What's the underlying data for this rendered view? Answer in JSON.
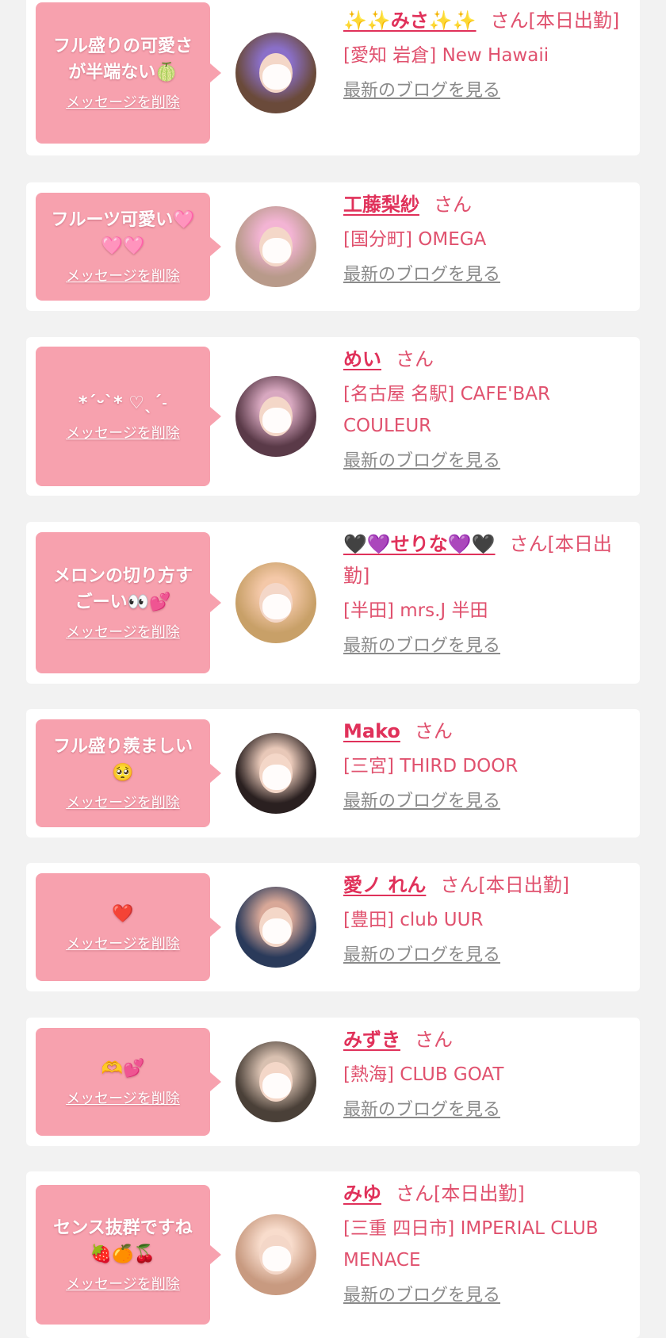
{
  "common": {
    "delete_label": "メッセージを削除",
    "blog_label": "最新のブログを見る",
    "san": "さん"
  },
  "colors": {
    "page_background": "#f2f2f2",
    "card_background": "#ffffff",
    "bubble": "#f7a1ae",
    "accent": "#e0315a",
    "shop_text": "#e0516e",
    "blog_link": "#8a8a8a"
  },
  "entries": [
    {
      "message": "フル盛りの可愛さ\nが半端ない🍈",
      "name": "✨✨みさ✨✨",
      "status": "[本日出勤]",
      "shop": "[愛知 岩倉] New Hawaii",
      "avatar_colors": [
        "#6a4a3a",
        "#8a6fc8"
      ]
    },
    {
      "message": "フルーツ可愛い🩷\n🩷🩷",
      "name": "工藤梨紗",
      "status": "",
      "shop": "[国分町] OMEGA",
      "avatar_colors": [
        "#b89a8a",
        "#f3b4d4"
      ]
    },
    {
      "message": "*ˊᵕˋ* ♡ˎˊ˗",
      "name": "めい",
      "status": "",
      "shop": "[名古屋 名駅] CAFE'BAR COULEUR",
      "avatar_colors": [
        "#5a3a48",
        "#d8a8c0"
      ]
    },
    {
      "message": "メロンの切り方す\nごーい👀💕",
      "name": "🖤💜せりな💜🖤",
      "status": "[本日出勤]",
      "shop": "[半田] mrs.J 半田",
      "avatar_colors": [
        "#c8a068",
        "#f4c8a8"
      ]
    },
    {
      "message": "フル盛り羨ましい\n🥺",
      "name": "Mako",
      "status": "",
      "shop": "[三宮] THIRD DOOR",
      "avatar_colors": [
        "#2a2020",
        "#e8c8b8"
      ]
    },
    {
      "message": "❤️",
      "name": "愛ノ れん",
      "status": "[本日出勤]",
      "shop": "[豊田] club UUR",
      "avatar_colors": [
        "#2a3a5a",
        "#d8a898"
      ]
    },
    {
      "message": "🫶💕",
      "name": "みずき",
      "status": "",
      "shop": "[熱海] CLUB GOAT",
      "avatar_colors": [
        "#4a4038",
        "#d8c0b0"
      ]
    },
    {
      "message": "センス抜群ですね\n🍓🍊🍒",
      "name": "みゆ",
      "status": "[本日出勤]",
      "shop": "[三重 四日市] IMPERIAL CLUB MENACE",
      "avatar_colors": [
        "#c89a80",
        "#f8dccc"
      ]
    }
  ]
}
